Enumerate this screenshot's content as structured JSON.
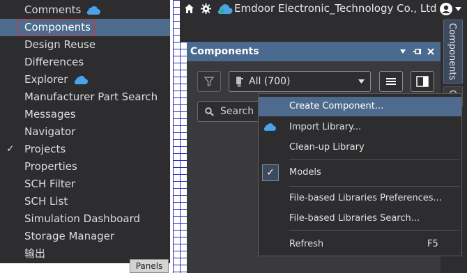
{
  "panels_menu": {
    "items": [
      {
        "label": "Comments",
        "cloud": true
      },
      {
        "label": "Components",
        "selected": true
      },
      {
        "label": "Design Reuse"
      },
      {
        "label": "Differences"
      },
      {
        "label": "Explorer",
        "cloud": true
      },
      {
        "label": "Manufacturer Part Search"
      },
      {
        "label": "Messages"
      },
      {
        "label": "Navigator"
      },
      {
        "label": "Projects",
        "checked": true
      },
      {
        "label": "Properties"
      },
      {
        "label": "SCH Filter"
      },
      {
        "label": "SCH List"
      },
      {
        "label": "Simulation Dashboard"
      },
      {
        "label": "Storage Manager"
      },
      {
        "label": "输出"
      }
    ],
    "panels_button": "Panels"
  },
  "topbar": {
    "title": "Emdoor Electronic_Technology Co., Ltd"
  },
  "right_dock": {
    "components_tab": "Components",
    "second_tab": "C"
  },
  "components_panel": {
    "title": "Components",
    "library_select": "All  (700)",
    "search_placeholder": "Search"
  },
  "context_menu": {
    "items": [
      {
        "label": "Create Component...",
        "highlighted": true
      },
      {
        "label": "Import Library...",
        "cloud": true
      },
      {
        "label": "Clean-up Library"
      },
      {
        "label": "Models",
        "checked": true
      },
      {
        "label": "File-based Libraries Preferences..."
      },
      {
        "label": "File-based Libraries Search..."
      },
      {
        "label": "Refresh",
        "shortcut": "F5"
      }
    ]
  },
  "colors": {
    "menu_bg": "#2d2d30",
    "selection": "#4e6a8c",
    "header": "#4a6a8f",
    "cloud_icon": "#4aa3e8",
    "highlight_border": "#e23030"
  },
  "icons": [
    "cloud-icon",
    "check-icon",
    "home-icon",
    "gear-icon",
    "user-icon",
    "filter-icon",
    "component-icon",
    "list-icon",
    "panel-view-icon",
    "search-icon",
    "pin-icon",
    "close-icon",
    "caret-down-icon"
  ]
}
